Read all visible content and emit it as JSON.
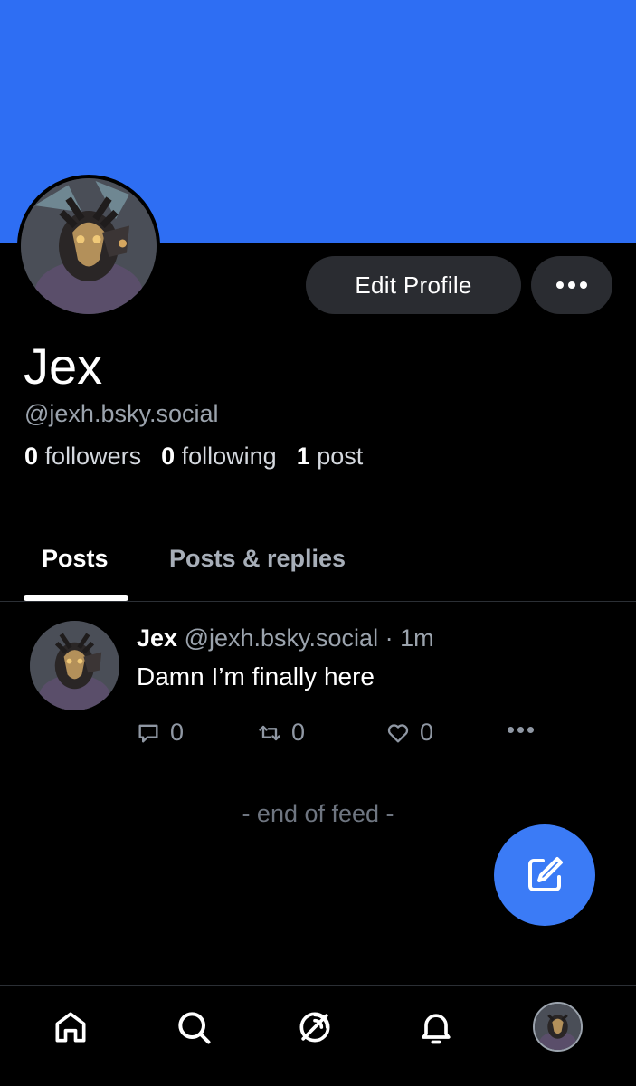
{
  "profile": {
    "display_name": "Jex",
    "handle": "@jexh.bsky.social",
    "edit_profile_label": "Edit Profile",
    "banner_color": "#2e6ef3",
    "stats": {
      "followers_count": "0",
      "followers_label": "followers",
      "following_count": "0",
      "following_label": "following",
      "posts_count": "1",
      "posts_label": "post"
    }
  },
  "tabs": [
    {
      "label": "Posts",
      "active": true
    },
    {
      "label": "Posts & replies",
      "active": false
    }
  ],
  "post": {
    "author": "Jex",
    "handle": "@jexh.bsky.social",
    "separator": " · ",
    "time": "1m",
    "text": "Damn I’m finally here",
    "reply_count": "0",
    "repost_count": "0",
    "like_count": "0"
  },
  "feed_end_text": "- end of feed -",
  "colors": {
    "accent": "#3b7bf6",
    "background": "#000000",
    "muted_text": "#9ba3ad"
  },
  "icons": {
    "more": "ellipsis-icon",
    "reply": "speech-bubble-icon",
    "repost": "repost-arrows-icon",
    "like": "heart-icon",
    "compose": "compose-pencil-icon",
    "home": "home-icon",
    "search": "search-icon",
    "feeds": "satellite-dish-icon",
    "notifications": "bell-icon"
  }
}
